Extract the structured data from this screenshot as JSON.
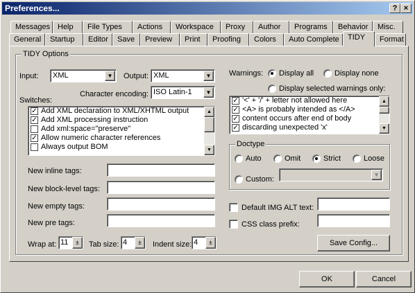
{
  "window": {
    "title": "Preferences..."
  },
  "titlebar": {
    "help": "?",
    "close": "×"
  },
  "tabs_row1": [
    "Messages",
    "Help",
    "File Types",
    "Actions",
    "Workspace",
    "Proxy",
    "Author",
    "Programs",
    "Behavior",
    "Misc."
  ],
  "tabs_row2": [
    "General",
    "Startup",
    "Editor",
    "Save",
    "Preview",
    "Print",
    "Proofing",
    "Colors",
    "Auto Complete",
    "TIDY",
    "Format"
  ],
  "tidy": {
    "group_title": "TIDY Options",
    "input_label": "Input:",
    "input_value": "XML",
    "output_label": "Output:",
    "output_value": "XML",
    "encoding_label": "Character encoding:",
    "encoding_value": "ISO Latin-1",
    "switches_label": "Switches:",
    "switches": [
      {
        "label": "Add XML declaration to XML/XHTML output",
        "checked": true
      },
      {
        "label": "Add XML processing instruction",
        "checked": true
      },
      {
        "label": "Add xml:space=\"preserve\"",
        "checked": false
      },
      {
        "label": "Allow numeric character references",
        "checked": true
      },
      {
        "label": "Always output BOM",
        "checked": false
      }
    ],
    "inline_tags_label": "New inline tags:",
    "block_tags_label": "New block-level tags:",
    "empty_tags_label": "New empty tags:",
    "pre_tags_label": "New pre tags:",
    "wrap_label": "Wrap at:",
    "wrap_value": "11",
    "tab_label": "Tab size:",
    "tab_value": "4",
    "indent_label": "Indent size:",
    "indent_value": "4",
    "warnings_label": "Warnings:",
    "display_all": "Display all",
    "display_none": "Display none",
    "display_selected": "Display selected warnings only:",
    "warnings": [
      {
        "label": "'<' + '/' + letter not allowed here",
        "checked": true
      },
      {
        "label": "<A> is probably intended as </A>",
        "checked": true
      },
      {
        "label": "content occurs after end of body",
        "checked": true
      },
      {
        "label": "discarding unexpected 'x'",
        "checked": true
      }
    ],
    "doctype_title": "Doctype",
    "doctype_auto": "Auto",
    "doctype_omit": "Omit",
    "doctype_strict": "Strict",
    "doctype_loose": "Loose",
    "doctype_custom": "Custom:",
    "default_alt_label": "Default IMG ALT text:",
    "css_prefix_label": "CSS class prefix:",
    "save_config": "Save Config..."
  },
  "footer": {
    "ok": "OK",
    "cancel": "Cancel"
  }
}
